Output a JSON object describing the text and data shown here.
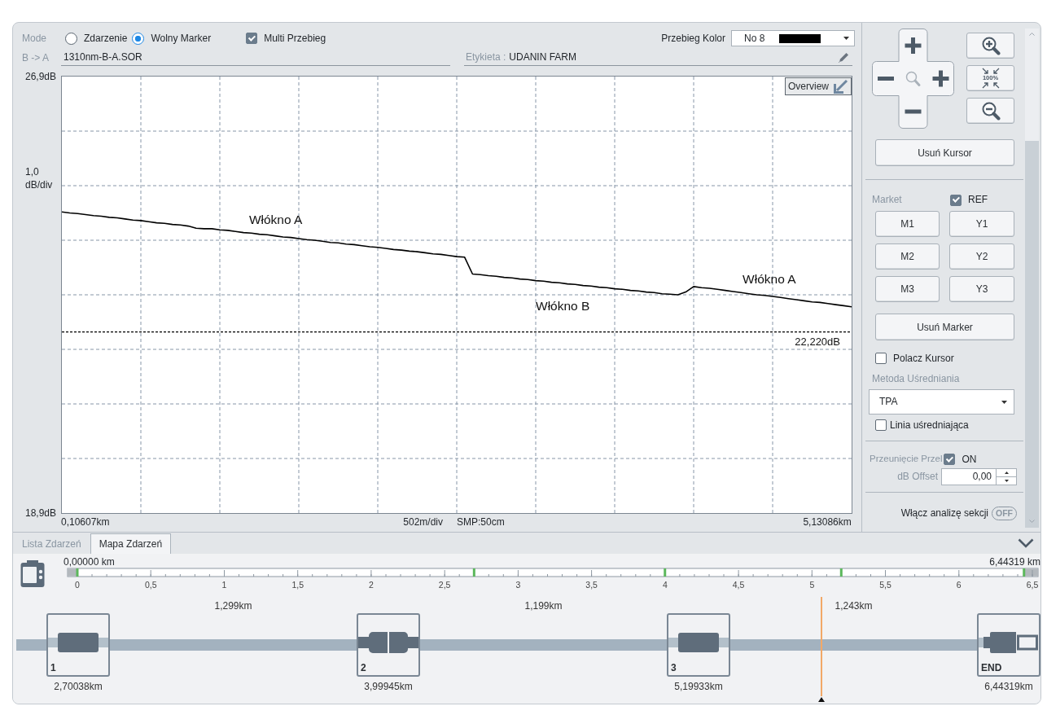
{
  "mode_bar": {
    "label": "Mode",
    "options": [
      {
        "label": "Zdarzenie",
        "selected": false
      },
      {
        "label": "Wolny Marker",
        "selected": true
      }
    ],
    "multi_trace": {
      "label": "Multi Przebieg",
      "checked": true
    },
    "trace_color": {
      "label": "Przebieg Kolor",
      "value": "No 8"
    }
  },
  "file_bar": {
    "direction": "B -> A",
    "file_name": "1310nm-B-A.SOR",
    "tag_caption": "Etykieta :",
    "tag_value": "UDANIN FARM"
  },
  "trace_view": {
    "overview_button": "Overview",
    "y_scale_value": "1,0",
    "y_scale_unit": "dB/div",
    "x_scale": "502m/div",
    "sampling": "SMP:50cm",
    "chart_data": {
      "type": "line",
      "categories": [
        null,
        null,
        null,
        "0,10607km",
        null,
        null,
        null,
        null,
        null,
        null,
        null,
        null,
        null,
        null,
        null,
        null,
        null,
        null,
        null,
        null,
        null,
        null,
        null,
        null,
        null,
        null,
        null,
        null,
        null,
        null,
        null,
        null,
        null,
        null,
        null,
        null,
        null,
        null,
        null,
        null,
        null,
        null,
        null,
        null,
        null,
        null,
        null,
        null,
        null,
        null,
        null,
        null,
        null,
        null,
        null,
        null,
        null,
        null,
        null,
        null,
        null,
        null,
        null,
        null,
        null,
        null,
        null,
        null,
        null,
        null,
        null,
        null,
        null,
        null,
        null,
        null,
        null,
        null,
        null,
        null,
        null,
        null,
        null,
        null,
        null,
        null,
        null,
        null,
        null,
        null,
        null,
        null,
        null,
        null,
        null,
        null,
        null,
        "5,13086km",
        null,
        null,
        null
      ],
      "series": [
        {
          "color": "#000000",
          "values": [
            24.42,
            24.4,
            24.39,
            24.37,
            24.35,
            24.34,
            24.32,
            24.31,
            24.29,
            24.27,
            24.26,
            24.24,
            24.22,
            24.21,
            24.19,
            24.18,
            24.16,
            24.12,
            24.11,
            24.11,
            24.09,
            24.08,
            24.06,
            24.04,
            24.03,
            24.01,
            24.0,
            23.98,
            23.96,
            23.95,
            23.93,
            23.91,
            23.9,
            23.88,
            23.86,
            23.85,
            23.83,
            23.82,
            23.8,
            23.78,
            23.77,
            23.75,
            23.73,
            23.72,
            23.7,
            23.69,
            23.67,
            23.65,
            23.64,
            23.62,
            23.6,
            23.59,
            23.28,
            23.27,
            23.25,
            23.24,
            23.22,
            23.21,
            23.19,
            23.18,
            23.16,
            23.15,
            23.13,
            23.12,
            23.1,
            23.09,
            23.07,
            23.06,
            23.04,
            23.03,
            23.01,
            23.0,
            22.98,
            22.97,
            22.95,
            22.94,
            22.92,
            22.91,
            22.9,
            22.95,
            23.05,
            23.03,
            23.02,
            23.0,
            22.98,
            22.96,
            22.94,
            22.92,
            22.9,
            22.89,
            22.87,
            22.85,
            22.83,
            22.81,
            22.79,
            22.77,
            22.76,
            22.74,
            22.72,
            22.7,
            22.68
          ]
        }
      ],
      "ylim": [
        18.9,
        26.9
      ],
      "yticks": [
        {
          "value": 26.9,
          "label": "26,9dB"
        },
        {
          "value": 18.9,
          "label": "18,9dB"
        }
      ],
      "annotations": [
        "Włókno A",
        "Włókno B",
        "Włókno A"
      ],
      "ref_lines": [
        {
          "axis": "y",
          "value": 22.22,
          "label": "22,220dB"
        }
      ]
    }
  },
  "side_panel": {
    "fit_button_label": "100%",
    "remove_cursor_button": "Usuń Kursor",
    "markers_label": "Market",
    "ref": {
      "label": "REF",
      "checked": true
    },
    "marker_buttons": [
      "M1",
      "Y1",
      "M2",
      "Y2",
      "M3",
      "Y3"
    ],
    "remove_marker_button": "Usuń Marker",
    "link_cursor": {
      "label": "Polacz Kursor",
      "checked": false
    },
    "averaging_label": "Metoda Uśredniania",
    "averaging_method": "TPA",
    "averaging_line": {
      "label": "Linia uśredniająca",
      "checked": false
    },
    "offset_shift": {
      "label": "Przeunięcie Przel",
      "checked": true,
      "checkbox_label": "ON"
    },
    "db_offset": {
      "label": "dB Offset",
      "value": "0,00"
    },
    "section_analysis": {
      "label": "Włącz analizę sekcji",
      "on": false,
      "toggle_text": "OFF"
    }
  },
  "bottom_tabs": [
    {
      "label": "Lista Zdarzeń",
      "selected": false
    },
    {
      "label": "Mapa Zdarzeń",
      "selected": true
    }
  ],
  "event_map": {
    "start_label": "0,00000 km",
    "end_label": "6,44319 km",
    "scale_labels": [
      "0",
      "0,5",
      "1",
      "1,5",
      "2",
      "2,5",
      "3",
      "3,5",
      "4",
      "4,5",
      "5",
      "5,5",
      "6",
      "6,5"
    ],
    "sections": [
      "1,299km",
      "1,199km",
      "1,243km"
    ],
    "events": [
      {
        "label": "1",
        "kind": "connector",
        "distance": "2,70038km"
      },
      {
        "label": "2",
        "kind": "mated",
        "distance": "3,99945km"
      },
      {
        "label": "3",
        "kind": "connector",
        "distance": "5,19933km"
      },
      {
        "label": "END",
        "kind": "end",
        "distance": "6,44319km"
      }
    ]
  }
}
